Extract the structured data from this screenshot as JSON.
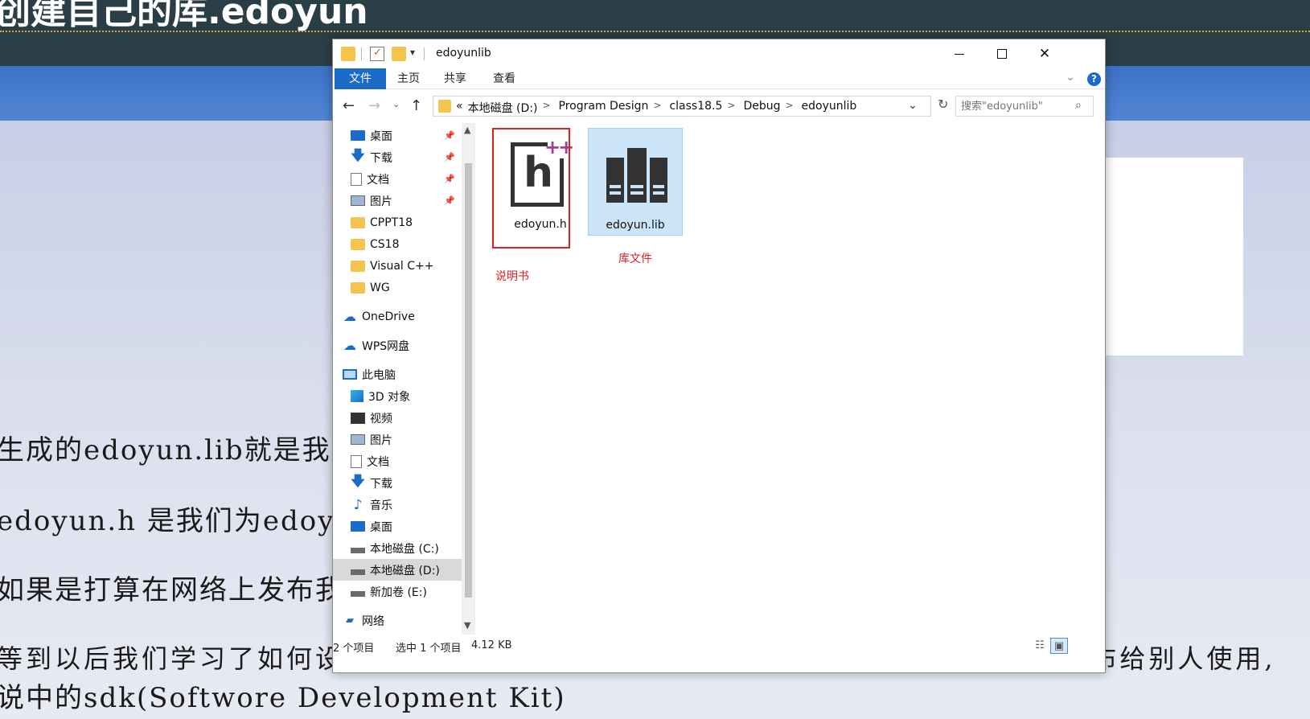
{
  "slide": {
    "title": "创建自己的库.edoyun",
    "lines": [
      "生成的edoyun.lib就是我们的",
      "edoyun.h 是我们为edoyun.lib",
      "如果是打算在网络上发布我",
      "等到以后我们学习了如何设计安装文件后,我们就可以把我们的库制作成一个安装包,发布给别人使用,",
      "说中的sdk(Softwore Development Kit)"
    ]
  },
  "window": {
    "title": "edoyunlib",
    "controls": {
      "minimize": "",
      "maximize": "",
      "close": "✕"
    }
  },
  "ribbon": {
    "tabs": [
      "文件",
      "主页",
      "共享",
      "查看"
    ],
    "help": "?"
  },
  "nav": {
    "back": "←",
    "forward": "→",
    "recent": "⌄",
    "up": "↑",
    "breadcrumb": [
      "«",
      "本地磁盘 (D:)",
      "Program Design",
      "class18.5",
      "Debug",
      "edoyunlib"
    ],
    "refresh": "↻",
    "search_placeholder": "搜索\"edoyunlib\"",
    "search_icon": "⌕"
  },
  "sidebar": {
    "items": [
      {
        "label": "桌面",
        "icon": "desktop-icon",
        "pinned": true
      },
      {
        "label": "下载",
        "icon": "download-icon",
        "pinned": true
      },
      {
        "label": "文档",
        "icon": "document-icon",
        "pinned": true
      },
      {
        "label": "图片",
        "icon": "pictures-icon",
        "pinned": true
      },
      {
        "label": "CPPT18",
        "icon": "folder-icon"
      },
      {
        "label": "CS18",
        "icon": "folder-icon"
      },
      {
        "label": "Visual C++",
        "icon": "folder-icon"
      },
      {
        "label": "WG",
        "icon": "folder-icon"
      },
      {
        "label": "OneDrive",
        "icon": "onedrive-icon"
      },
      {
        "label": "WPS网盘",
        "icon": "wps-cloud-icon"
      },
      {
        "label": "此电脑",
        "icon": "this-pc-icon"
      },
      {
        "label": "3D 对象",
        "icon": "3d-objects-icon"
      },
      {
        "label": "视频",
        "icon": "video-icon"
      },
      {
        "label": "图片",
        "icon": "pictures-icon"
      },
      {
        "label": "文档",
        "icon": "document-icon"
      },
      {
        "label": "下载",
        "icon": "download-icon"
      },
      {
        "label": "音乐",
        "icon": "music-icon"
      },
      {
        "label": "桌面",
        "icon": "desktop-icon"
      },
      {
        "label": "本地磁盘 (C:)",
        "icon": "drive-icon"
      },
      {
        "label": "本地磁盘 (D:)",
        "icon": "drive-icon",
        "selected": true
      },
      {
        "label": "新加卷 (E:)",
        "icon": "drive-icon"
      },
      {
        "label": "网络",
        "icon": "network-icon"
      }
    ],
    "pin_glyph": "📌"
  },
  "files": [
    {
      "name": "edoyun.h",
      "icon": "cpp-header-icon",
      "glyph": "h",
      "plus": "++",
      "selected": false
    },
    {
      "name": "edoyun.lib",
      "icon": "library-file-icon",
      "selected": true
    }
  ],
  "annotations": {
    "header_note": "说明书",
    "lib_note": "库文件"
  },
  "status": {
    "count": "2 个项目",
    "selection": "选中 1 个项目",
    "size": "4.12 KB"
  },
  "colors": {
    "accent": "#1a6cc8",
    "annotation": "#e02020",
    "selection": "#cce4f7"
  }
}
